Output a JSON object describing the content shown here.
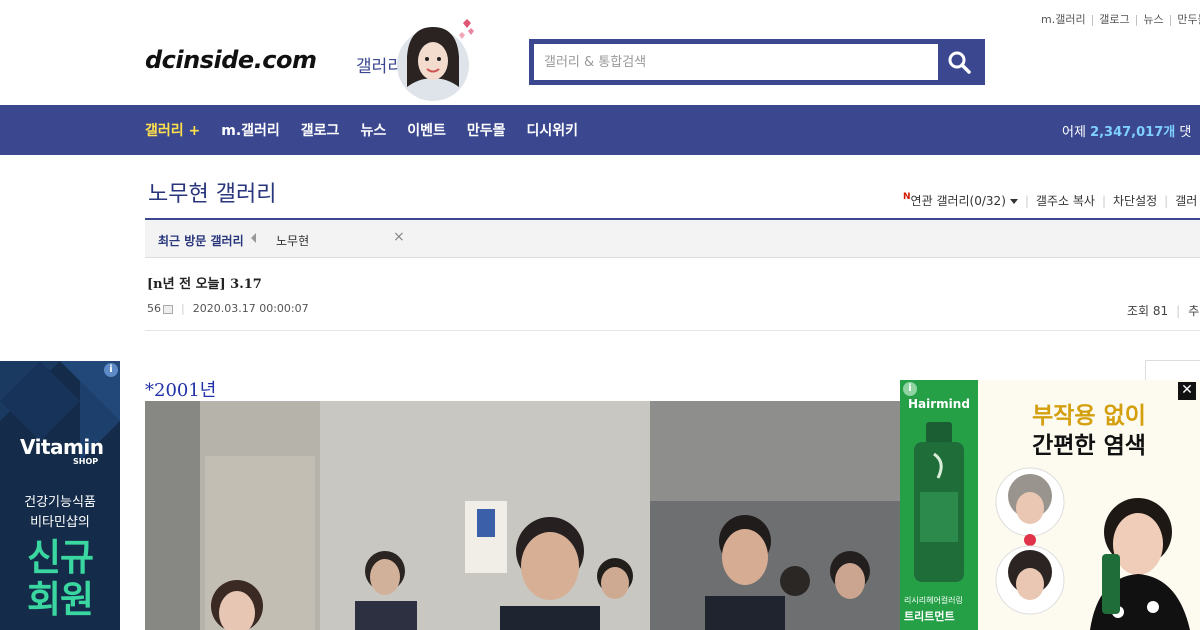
{
  "top_util": {
    "links": [
      "m.갤러리",
      "갤로그",
      "뉴스",
      "만두몰"
    ]
  },
  "header": {
    "logo": "dcinside.com",
    "logo_sub": "갤러리",
    "search_placeholder": "갤러리 & 통합검색"
  },
  "nav": {
    "items": [
      "갤러리 +",
      "m.갤러리",
      "갤로그",
      "뉴스",
      "이벤트",
      "만두몰",
      "디시위키"
    ],
    "stat_prefix": "어제",
    "stat_value": "2,347,017개",
    "stat_suffix": "댓"
  },
  "gallery": {
    "title": "노무현 갤러리",
    "new_badge": "N",
    "tools": [
      "연관 갤러리(0/32)",
      "갤주소 복사",
      "차단설정",
      "갤러"
    ]
  },
  "recent": {
    "label": "최근 방문 갤러리",
    "item": "노무현",
    "close": "×"
  },
  "post": {
    "title": "[n년 전 오늘] 3.17",
    "writer": "56",
    "date": "2020.03.17 00:00:07",
    "views": "조회 81",
    "rec": "추"
  },
  "content": {
    "year": "*2001년"
  },
  "ad_left": {
    "info": "i",
    "brand": "Vitamin",
    "brand_sub": "SHOP",
    "line1": "건강기능식품",
    "line2": "비타민샵의",
    "big1": "신규",
    "big2": "회원"
  },
  "ad_right": {
    "info": "i",
    "brand": "Hairmind",
    "head1": "부작용 없이",
    "head2": "간편한 염색",
    "tag1": "리시리헤어컬러링",
    "tag2": "트리트먼트",
    "close": "✕"
  },
  "colors": {
    "brand_blue": "#3b4890",
    "accent_yellow": "#ffe14a",
    "stat_blue": "#7fd0ff",
    "ad_left_bg": "#142c4a",
    "ad_right_green": "#25a047"
  }
}
